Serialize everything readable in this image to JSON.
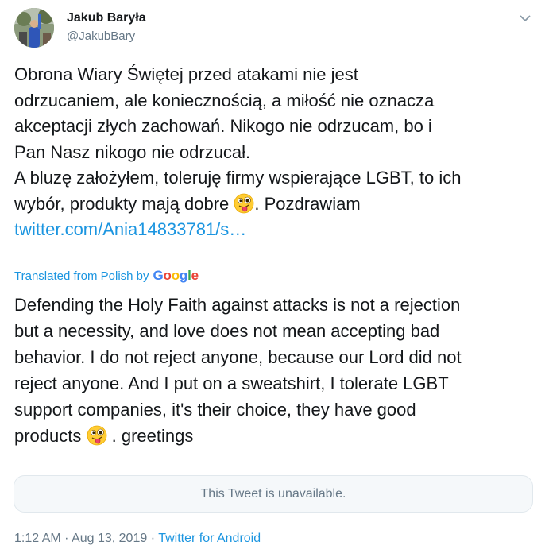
{
  "user": {
    "display_name": "Jakub Baryła",
    "handle": "@JakubBary"
  },
  "tweet": {
    "lines": [
      "Obrona Wiary Świętej przed atakami nie jest",
      "odrzucaniem, ale koniecznością, a miłość nie oznacza",
      "akceptacji złych zachowań. Nikogo nie odrzucam, bo i",
      "Pan Nasz nikogo nie odrzucał.",
      "A bluzę założyłem, toleruję firmy wspierające LGBT, to ich"
    ],
    "line6_before_emoji": "wybór, produkty mają dobre ",
    "line6_after_emoji": ". Pozdrawiam",
    "link": "twitter.com/Ania14833781/s…"
  },
  "translation": {
    "label": "Translated from Polish by",
    "provider": {
      "letters": [
        "G",
        "o",
        "o",
        "g",
        "l",
        "e"
      ]
    },
    "lines": [
      "Defending the Holy Faith against attacks is not a rejection",
      "but a necessity, and love does not mean accepting bad",
      "behavior. I do not reject anyone, because our Lord did not",
      "reject anyone. And I put on a sweatshirt, I tolerate LGBT",
      "support companies, it's their choice, they have good"
    ],
    "last_line_before_emoji": "products ",
    "last_line_after_emoji": " . greetings"
  },
  "quoted_unavailable": "This Tweet is unavailable.",
  "meta": {
    "time": "1:12 AM",
    "sep1": " · ",
    "date": "Aug 13, 2019",
    "sep2": " · ",
    "source": "Twitter for Android"
  },
  "icons": {
    "caret": "chevron-down-icon",
    "emoji": "winking-face-with-tongue-emoji"
  }
}
